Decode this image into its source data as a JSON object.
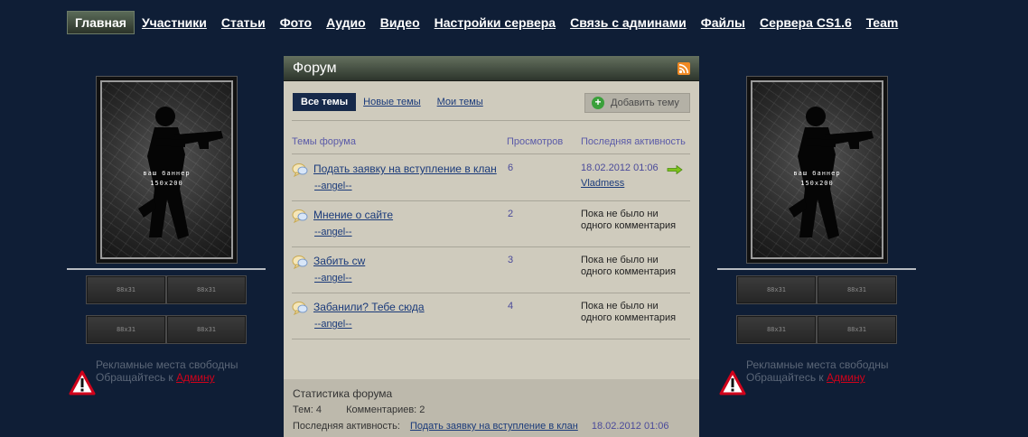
{
  "nav": {
    "items": [
      "Главная",
      "Участники",
      "Статьи",
      "Фото",
      "Аудио",
      "Видео",
      "Настройки сервера",
      "Связь с админами",
      "Файлы",
      "Сервера CS1.6",
      "Team"
    ]
  },
  "side": {
    "banner_text_1": "ваш баннер",
    "banner_text_2": "150x200",
    "mini_label": "88x31",
    "ad_line_1": "Рекламные места свободны",
    "ad_line_2": "Обращайтесь к",
    "ad_link": "Админу"
  },
  "forum": {
    "title": "Форум",
    "tabs": [
      "Все темы",
      "Новые темы",
      "Мои темы"
    ],
    "add_topic": "Добавить тему",
    "columns": {
      "topics": "Темы форума",
      "views": "Просмотров",
      "last": "Последняя активность"
    },
    "rows": [
      {
        "title": "Подать заявку на вступление в клан",
        "author": "--angel--",
        "views": "6",
        "last_date": "18.02.2012 01:06",
        "last_user": "Vladmess"
      },
      {
        "title": "Мнение о сайте",
        "author": "--angel--",
        "views": "2",
        "last_text": "Пока не было ни одного комментария"
      },
      {
        "title": "Забить cw",
        "author": "--angel--",
        "views": "3",
        "last_text": "Пока не было ни одного комментария"
      },
      {
        "title": "Забанили? Тебе сюда",
        "author": "--angel--",
        "views": "4",
        "last_text": "Пока не было ни одного комментария"
      }
    ],
    "stats": {
      "heading": "Статистика форума",
      "topics_label": "Тем: 4",
      "comments_label": "Комментариев: 2",
      "last_label": "Последняя активность:",
      "last_link": "Подать заявку на вступление в клан",
      "last_date": "18.02.2012 01:06"
    }
  },
  "colors": {
    "background": "#0f1e36",
    "forum_panel": "#cfcbbd",
    "link": "#1a3a7a",
    "ad_link": "#d0021b"
  }
}
